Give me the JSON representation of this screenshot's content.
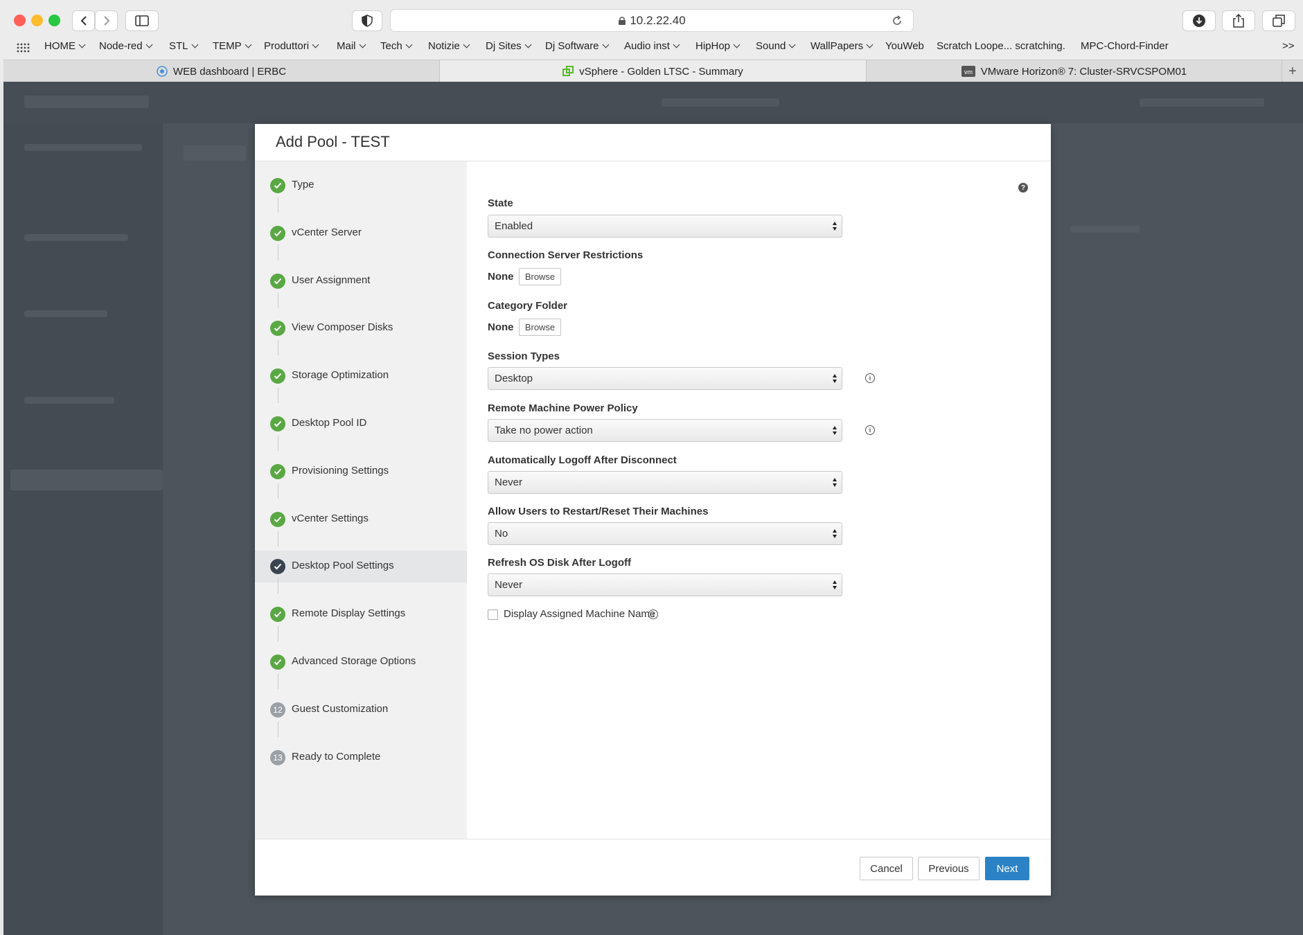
{
  "browser": {
    "url": "10.2.22.40",
    "bookmarks": [
      {
        "label": "HOME",
        "menu": true
      },
      {
        "label": "Node-red",
        "menu": true
      },
      {
        "label": "STL",
        "menu": true
      },
      {
        "label": "TEMP",
        "menu": true
      },
      {
        "label": "Produttori",
        "menu": true
      },
      {
        "label": "Mail",
        "menu": true
      },
      {
        "label": "Tech",
        "menu": true
      },
      {
        "label": "Notizie",
        "menu": true
      },
      {
        "label": "Dj Sites",
        "menu": true
      },
      {
        "label": "Dj Software",
        "menu": true
      },
      {
        "label": "Audio inst",
        "menu": true
      },
      {
        "label": "HipHop",
        "menu": true
      },
      {
        "label": "Sound",
        "menu": true
      },
      {
        "label": "WallPapers",
        "menu": true
      },
      {
        "label": "YouWeb",
        "menu": false
      },
      {
        "label": "Scratch Loope... scratching.",
        "menu": false
      },
      {
        "label": "MPC-Chord-Finder",
        "menu": false
      }
    ],
    "tabs": [
      {
        "label": "WEB dashboard | ERBC",
        "icon": "dashboard-icon"
      },
      {
        "label": "vSphere - Golden LTSC - Summary",
        "icon": "vsphere-icon"
      },
      {
        "label": "VMware Horizon® 7: Cluster-SRVCSPOM01",
        "icon": "vm-icon"
      }
    ],
    "new_tab_label": "+",
    "overflow_label": ">>"
  },
  "modal": {
    "title": "Add Pool - TEST",
    "steps": [
      {
        "label": "Type",
        "status": "done"
      },
      {
        "label": "vCenter Server",
        "status": "done"
      },
      {
        "label": "User Assignment",
        "status": "done"
      },
      {
        "label": "View Composer Disks",
        "status": "done"
      },
      {
        "label": "Storage Optimization",
        "status": "done"
      },
      {
        "label": "Desktop Pool ID",
        "status": "done"
      },
      {
        "label": "Provisioning Settings",
        "status": "done"
      },
      {
        "label": "vCenter Settings",
        "status": "done"
      },
      {
        "label": "Desktop Pool Settings",
        "status": "current"
      },
      {
        "label": "Remote Display Settings",
        "status": "done"
      },
      {
        "label": "Advanced Storage Options",
        "status": "done"
      },
      {
        "label": "Guest Customization",
        "status": "todo",
        "number": "12"
      },
      {
        "label": "Ready to Complete",
        "status": "todo",
        "number": "13"
      }
    ],
    "form": {
      "state_label": "State",
      "state_value": "Enabled",
      "conn_label": "Connection Server Restrictions",
      "conn_value": "None",
      "category_label": "Category Folder",
      "category_value": "None",
      "browse_label": "Browse",
      "session_label": "Session Types",
      "session_value": "Desktop",
      "power_label": "Remote Machine Power Policy",
      "power_value": "Take no power action",
      "logoff_label": "Automatically Logoff After Disconnect",
      "logoff_value": "Never",
      "restart_label": "Allow Users to Restart/Reset Their Machines",
      "restart_value": "No",
      "refresh_label": "Refresh OS Disk After Logoff",
      "refresh_value": "Never",
      "display_name_label": "Display Assigned Machine Name",
      "display_name_checked": false
    },
    "footer": {
      "cancel": "Cancel",
      "previous": "Previous",
      "next": "Next"
    }
  },
  "colors": {
    "primary": "#2b82c6",
    "step_done": "#5aa844",
    "step_current": "#3a4350",
    "step_todo": "#9aa0a6"
  }
}
